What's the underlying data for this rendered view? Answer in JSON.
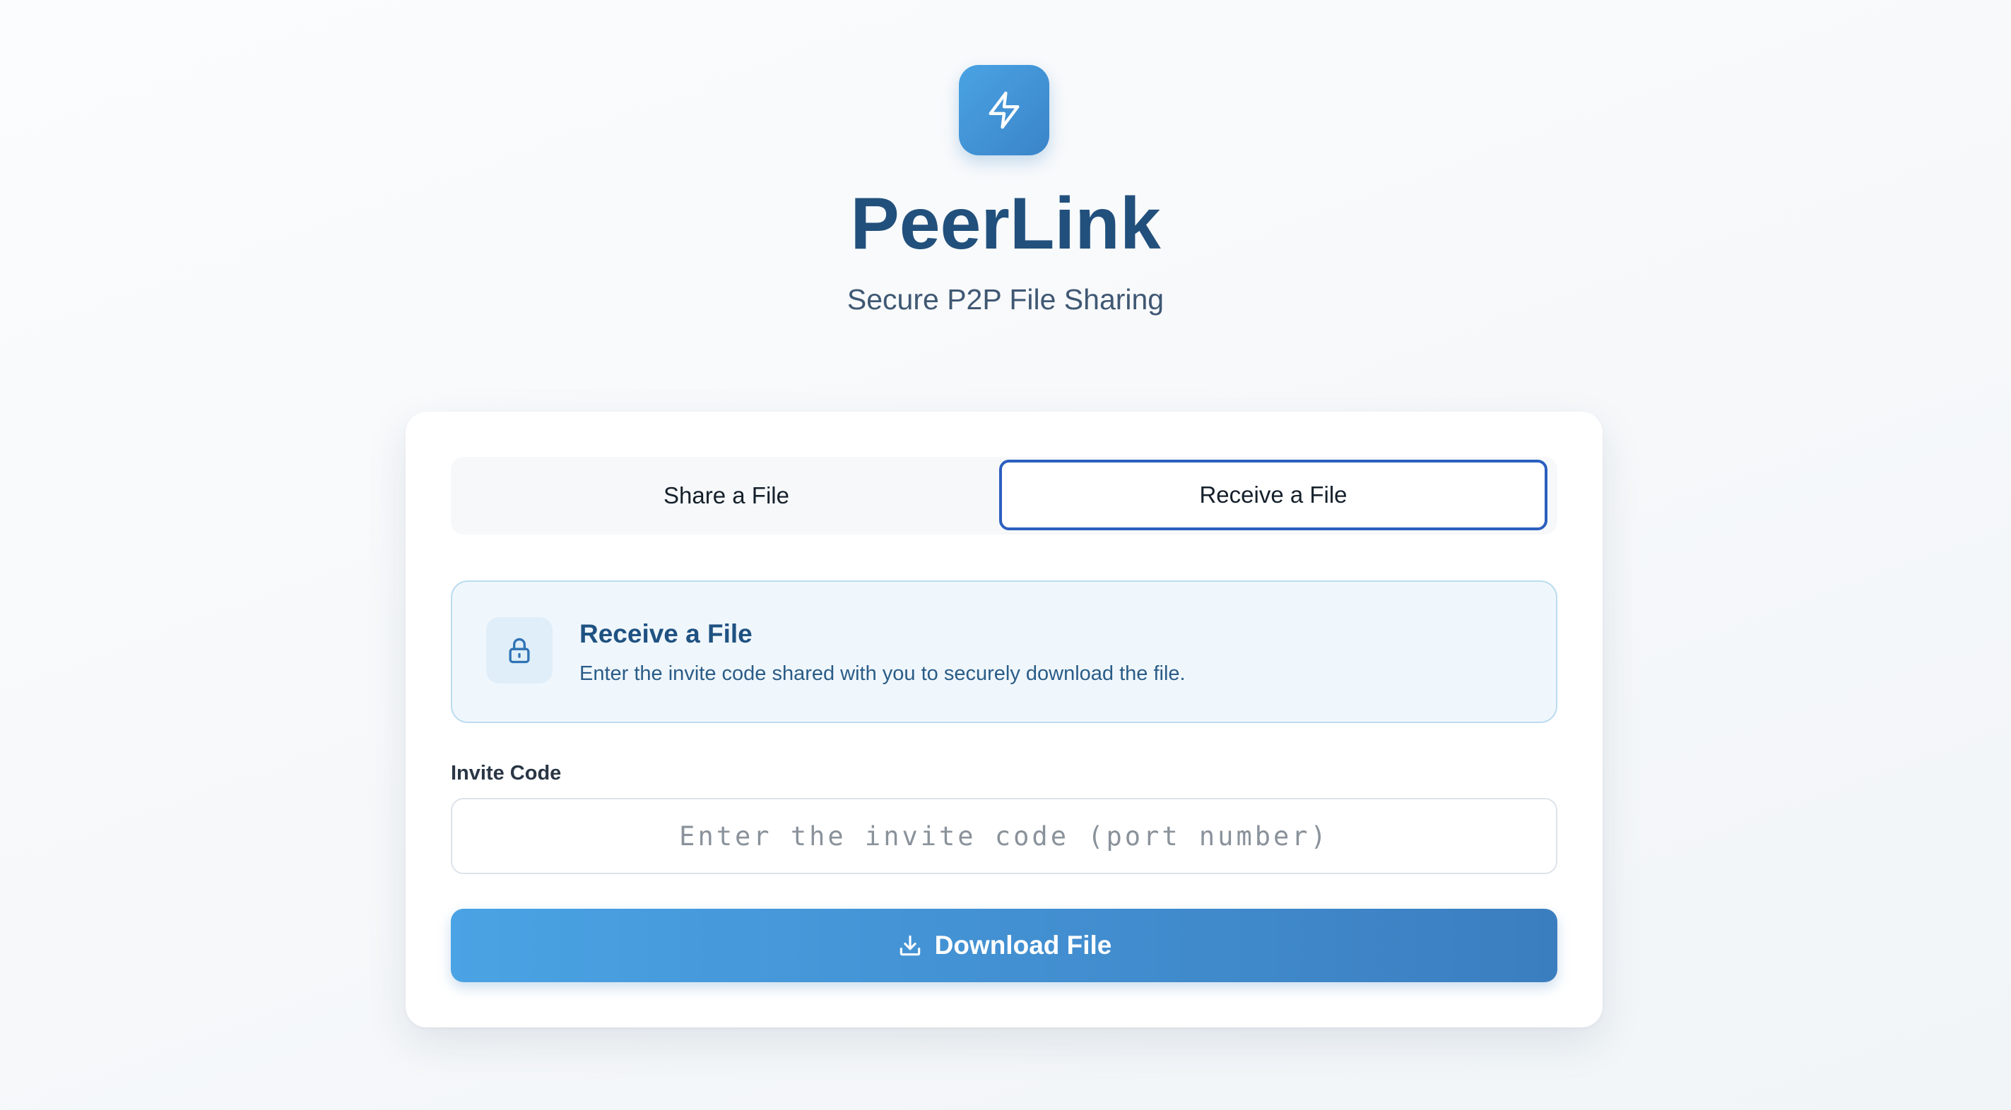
{
  "app": {
    "title": "PeerLink",
    "subtitle": "Secure P2P File Sharing",
    "logo_icon": "lightning-bolt-icon",
    "accent_color": "#3a84c8",
    "title_color": "#22507c"
  },
  "tabs": [
    {
      "label": "Share a File",
      "active": false
    },
    {
      "label": "Receive a File",
      "active": true
    }
  ],
  "info": {
    "icon": "lock-icon",
    "title": "Receive a File",
    "text": "Enter the invite code shared with you to securely download the file."
  },
  "invite": {
    "label": "Invite Code",
    "placeholder": "Enter the invite code (port number)",
    "value": ""
  },
  "download": {
    "icon": "download-icon",
    "label": "Download File"
  }
}
